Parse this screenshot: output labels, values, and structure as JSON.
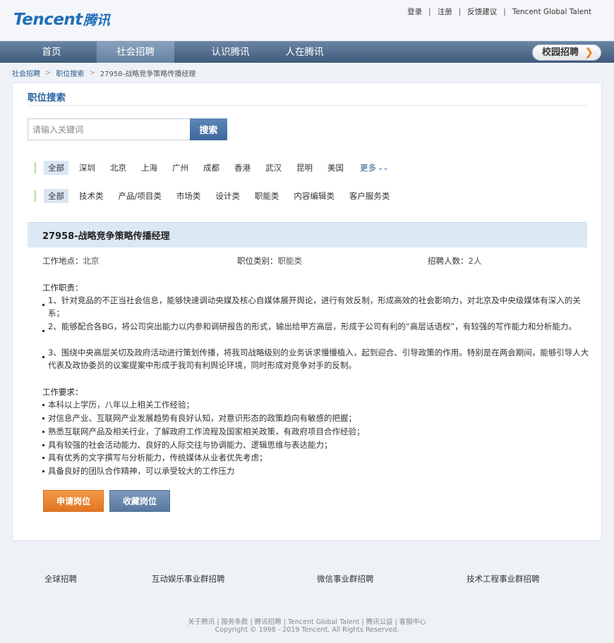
{
  "header": {
    "logo_en": "Tencent",
    "logo_cn": "腾讯",
    "links": [
      "登录",
      "注册",
      "反馈建议",
      "Tencent Global Talent"
    ]
  },
  "nav": {
    "items": [
      "首页",
      "社会招聘",
      "认识腾讯",
      "人在腾讯"
    ],
    "active": "社会招聘",
    "campus_button": "校园招聘"
  },
  "breadcrumb": [
    "社会招聘",
    "职位搜索",
    "27958-战略竞争策略传播经理"
  ],
  "search": {
    "title": "职位搜索",
    "placeholder": "请输入关键词",
    "button": "搜索"
  },
  "filters": {
    "locations": [
      "全部",
      "深圳",
      "北京",
      "上海",
      "广州",
      "成都",
      "香港",
      "武汉",
      "昆明",
      "美国"
    ],
    "more": "更多",
    "categories": [
      "全部",
      "技术类",
      "产品/项目类",
      "市场类",
      "设计类",
      "职能类",
      "内容编辑类",
      "客户服务类"
    ]
  },
  "job": {
    "title": "27958-战略竞争策略传播经理",
    "location_label": "工作地点：",
    "location": "北京",
    "category_label": "职位类别：",
    "category": "职能类",
    "headcount_label": "招聘人数：",
    "headcount": "2人",
    "duties_title": "工作职责：",
    "duties": [
      "1、针对竞品的不正当社会信息，能够快速调动央媒及核心自媒体展开舆论，进行有效反制，形成高效的社会影响力，对北京及中央级媒体有深入的关系；",
      "2、能够配合各BG，将公司突出能力以内参和调研报告的形式，输出给甲方高层，形成于公司有利的“高层话语权”，有较强的写作能力和分析能力。",
      "3、围绕中央高层关切及政府活动进行策划传播，将我司战略级别的业务诉求慢慢植入，起到迎合、引导政策的作用。特别是在两会期间，能够引导人大代表及政协委员的议案提案中形成于我司有利舆论环境，同时形成对竞争对手的反制。"
    ],
    "requirements_title": "工作要求：",
    "requirements": [
      "本科以上学历，八年以上相关工作经验；",
      "对信息产业、互联网产业发展趋势有良好认知，对意识形态的政策趋向有敏感的把握；",
      "熟悉互联网产品及相关行业，了解政府工作流程及国家相关政策，有政府项目合作经验；",
      "具有较强的社会活动能力、良好的人际交往与协调能力、逻辑思维与表达能力；",
      "具有优秀的文字撰写与分析能力，传统媒体从业者优先考虑；",
      "具备良好的团队合作精神，可以承受较大的工作压力"
    ],
    "apply_button": "申请岗位",
    "save_button": "收藏岗位"
  },
  "footer": {
    "groups": [
      "全球招聘",
      "互动娱乐事业群招聘",
      "微信事业群招聘",
      "技术工程事业群招聘"
    ],
    "links": [
      "关于腾讯",
      "服务条款",
      "腾讯招聘",
      "Tencent Global Talent",
      "腾讯公益",
      "客服中心"
    ],
    "copyright": "Copyright © 1998 - 2019 Tencent. All Rights Reserved."
  }
}
